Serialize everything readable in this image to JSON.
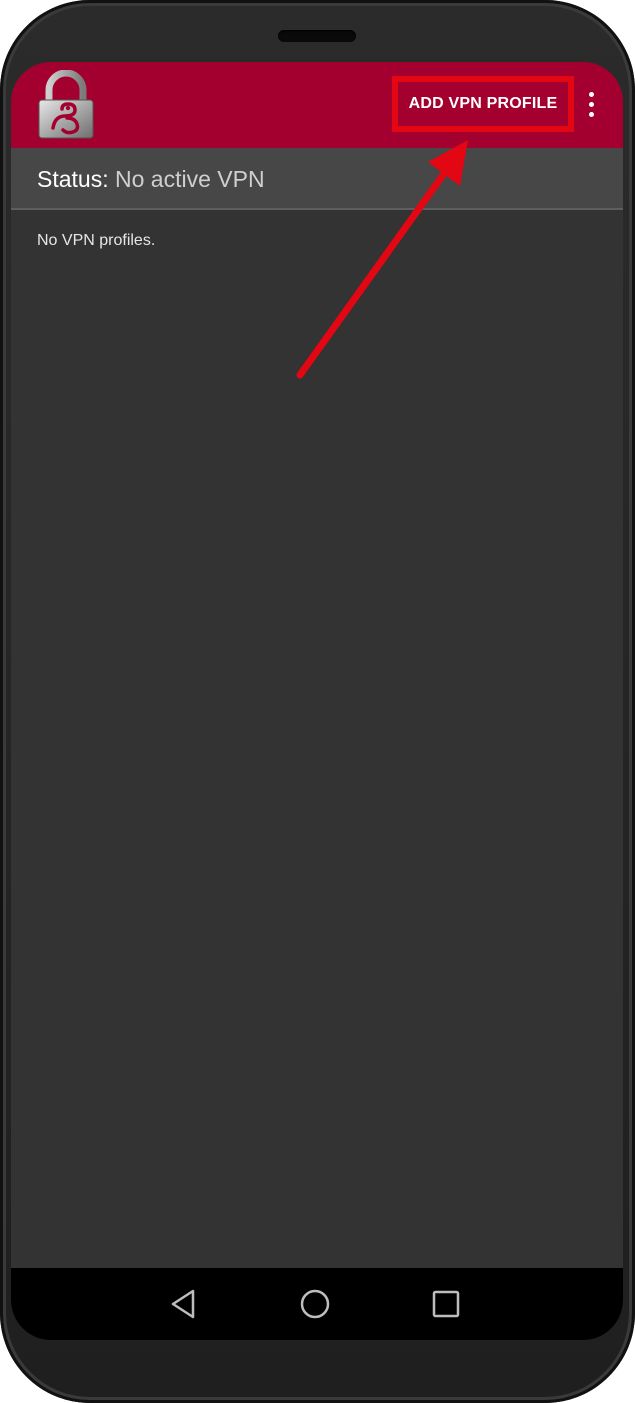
{
  "device": {
    "type": "android-phone"
  },
  "app_bar": {
    "background_color": "#a3002f",
    "icon": "padlock-app-icon",
    "action_label": "ADD VPN PROFILE",
    "overflow_icon": "more-vert-icon"
  },
  "status": {
    "label": "Status:",
    "value": "No active VPN"
  },
  "content": {
    "empty_message": "No VPN profiles."
  },
  "annotation": {
    "highlight_color": "#e30613",
    "arrow_icon": "red-pointer-arrow"
  },
  "nav_bar": {
    "back_icon": "back-triangle-icon",
    "home_icon": "home-circle-icon",
    "recents_icon": "recents-square-icon"
  }
}
